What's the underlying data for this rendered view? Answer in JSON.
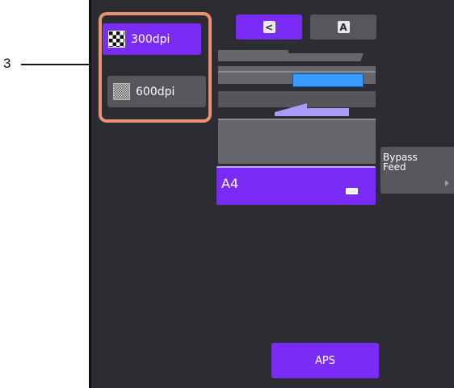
{
  "callout": {
    "number": "3"
  },
  "resolution": {
    "options": [
      {
        "label": "300dpi",
        "selected": true
      },
      {
        "label": "600dpi",
        "selected": false
      }
    ]
  },
  "view_tabs": {
    "left_icon": "<",
    "right_icon": "A"
  },
  "paper": {
    "size": "A4",
    "tray_icon": "tray-icon"
  },
  "bypass": {
    "line1": "Bypass",
    "line2": "Feed"
  },
  "aps": {
    "label": "APS"
  },
  "colors": {
    "accent": "#7a2cf5",
    "highlight": "#eb9270",
    "panel_bg": "#2c2d32",
    "button_gray": "#56565c"
  }
}
